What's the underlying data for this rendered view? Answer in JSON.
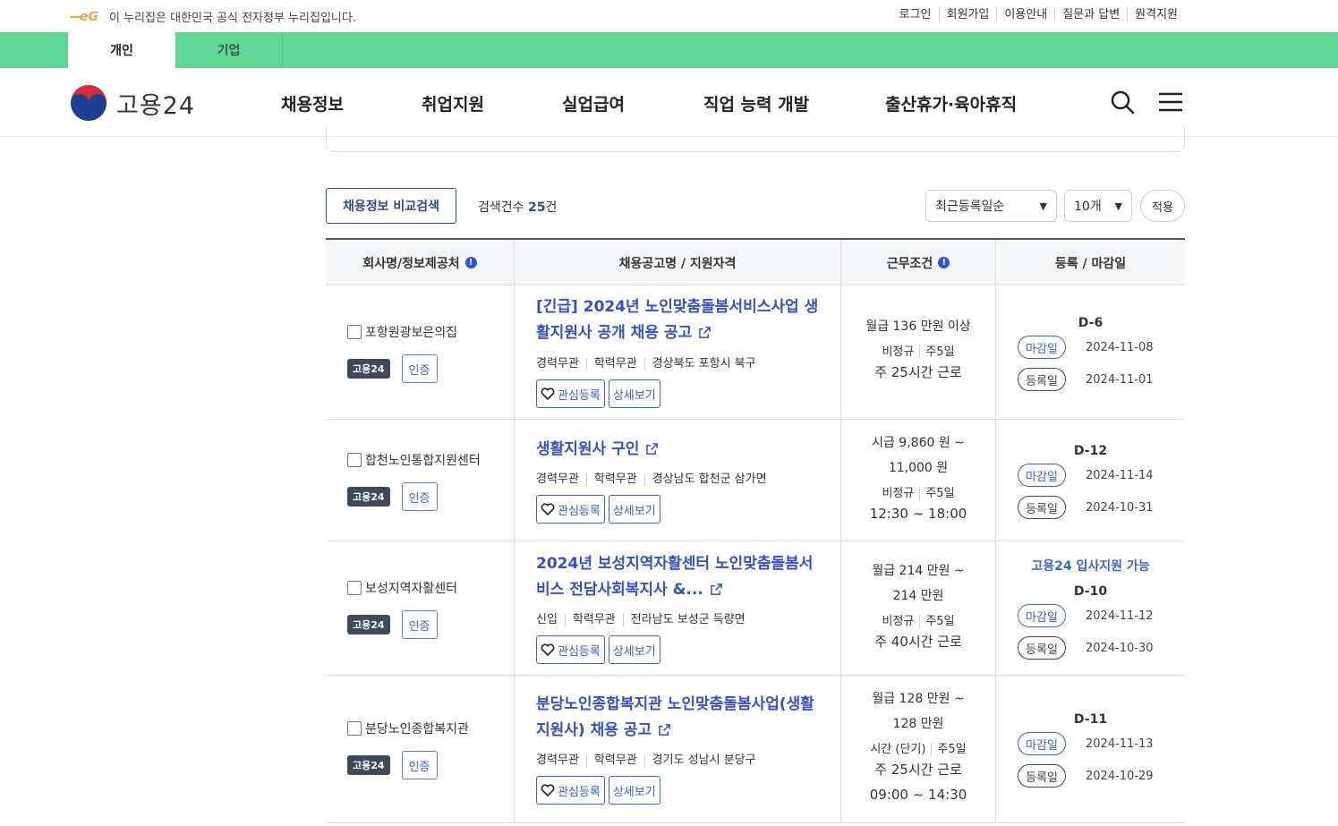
{
  "gov_banner": {
    "text": "이 누리집은 대한민국 공식 전자정부 누리집입니다."
  },
  "util_links": [
    "로그인",
    "회원가입",
    "이용안내",
    "질문과 답변",
    "원격지원"
  ],
  "user_tabs": [
    "개인",
    "기업"
  ],
  "brand": {
    "name": "고용24"
  },
  "main_menu": [
    "채용정보",
    "취업지원",
    "실업급여",
    "직업 능력 개발",
    "출산휴가·육아휴직"
  ],
  "controls": {
    "compare_button": "채용정보 비교검색",
    "count_label": "검색건수",
    "count_value": "25",
    "count_unit": "건",
    "sort_selected": "최근등록일순",
    "page_size_selected": "10개",
    "apply_button": "적용"
  },
  "table": {
    "headers": [
      "회사명/정보제공처",
      "채용공고명 / 지원자격",
      "근무조건",
      "등록 / 마감일"
    ],
    "labels": {
      "source_badge": "고용24",
      "cert_badge": "인증",
      "favorite": "관심등록",
      "detail": "상세보기",
      "due": "마감일",
      "registered": "등록일"
    },
    "rows": [
      {
        "company": "포항원광보은의집",
        "title": "[긴급] 2024년 노인맞춤돌봄서비스사업 생활지원사 공개 채용 공고",
        "title_lines": [
          "[긴급] 2024년 노인맞춤돌봄서비스사업 생",
          "활지원사 공개 채용 공고"
        ],
        "tags": [
          "경력무관",
          "학력무관",
          "경상북도 포항시 북구"
        ],
        "pay_lines": [
          "월급 136 만원 이상"
        ],
        "type": [
          "비정규",
          "주5일"
        ],
        "hours_lines": [
          "주 25시간 근로"
        ],
        "hire_note": "",
        "dday": "D-6",
        "due_date": "2024-11-08",
        "reg_date": "2024-11-01"
      },
      {
        "company": "합천노인통합지원센터",
        "title": "생활지원사 구인",
        "title_lines": [
          "생활지원사 구인"
        ],
        "tags": [
          "경력무관",
          "학력무관",
          "경상남도 합천군 삼가면"
        ],
        "pay_lines": [
          "시급 9,860 원 ~",
          "11,000 원"
        ],
        "type": [
          "비정규",
          "주5일"
        ],
        "hours_lines": [
          "12:30 ~ 18:00"
        ],
        "hire_note": "",
        "dday": "D-12",
        "due_date": "2024-11-14",
        "reg_date": "2024-10-31"
      },
      {
        "company": "보성지역자활센터",
        "title": "2024년 보성지역자활센터 노인맞춤돌봄서비스 전담사회복지사 &...",
        "title_lines": [
          "2024년 보성지역자활센터 노인맞춤돌봄서",
          "비스 전담사회복지사 &..."
        ],
        "tags": [
          "신입",
          "학력무관",
          "전라남도 보성군 득량면"
        ],
        "pay_lines": [
          "월급 214 만원 ~",
          "214 만원"
        ],
        "type": [
          "비정규",
          "주5일"
        ],
        "hours_lines": [
          "주 40시간 근로"
        ],
        "hire_note": "고용24 입사지원 가능",
        "dday": "D-10",
        "due_date": "2024-11-12",
        "reg_date": "2024-10-30"
      },
      {
        "company": "분당노인종합복지관",
        "title": "분당노인종합복지관 노인맞춤돌봄사업(생활지원사) 채용 공고",
        "title_lines": [
          "분당노인종합복지관 노인맞춤돌봄사업(생활",
          "지원사) 채용 공고"
        ],
        "tags": [
          "경력무관",
          "학력무관",
          "경기도 성남시 분당구"
        ],
        "pay_lines": [
          "월급 128 만원 ~",
          "128 만원"
        ],
        "type": [
          "시간 (단기)",
          "주5일"
        ],
        "hours_lines": [
          "주 25시간 근로",
          "09:00 ~ 14:30"
        ],
        "hire_note": "",
        "dday": "D-11",
        "due_date": "2024-11-13",
        "reg_date": "2024-10-29"
      }
    ]
  },
  "colors": {
    "green_bar": "#5fd693",
    "accent_blue": "#3650c2",
    "navy": "#2d4d8c",
    "badge_dark": "#3c4a5c"
  }
}
